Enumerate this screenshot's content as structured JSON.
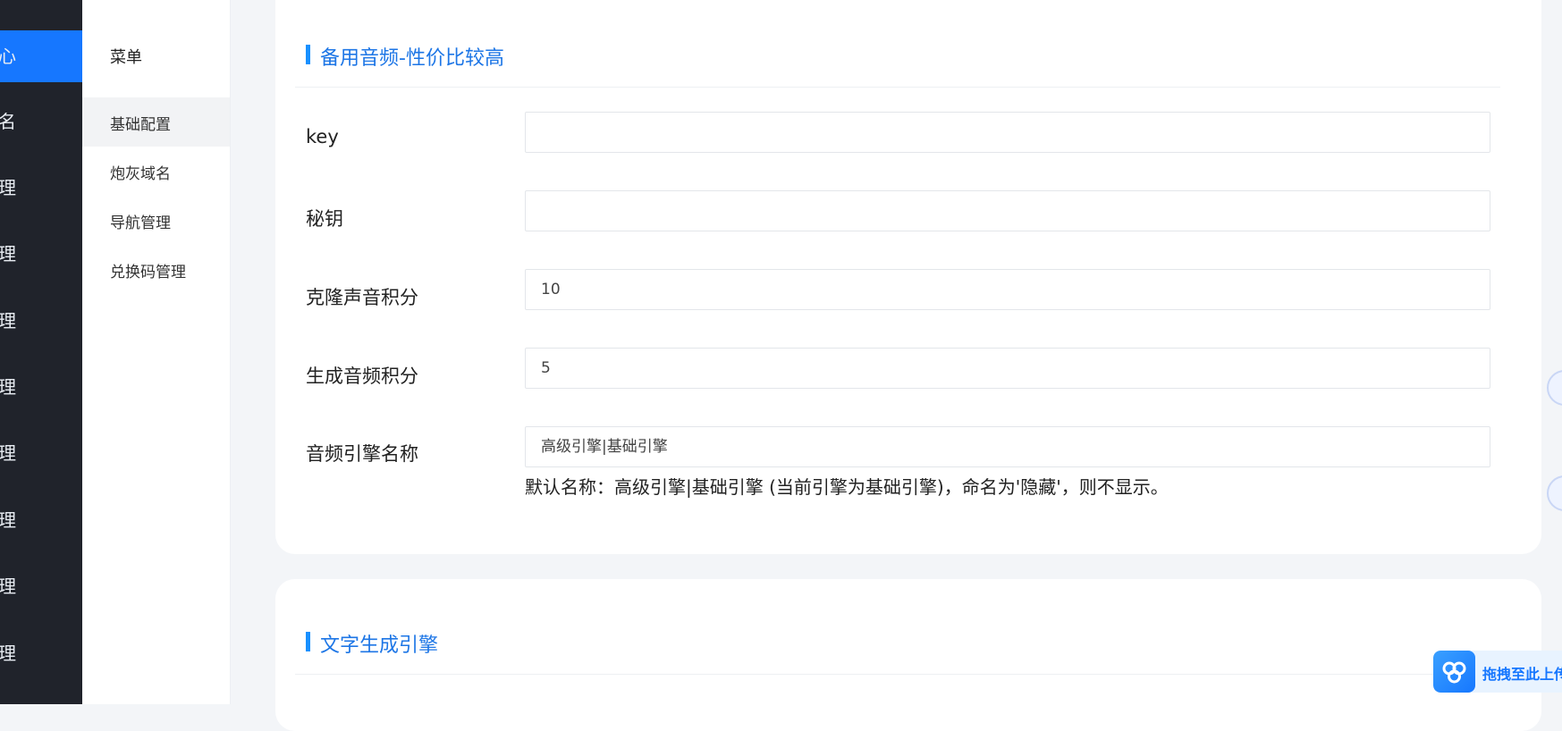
{
  "main_nav": {
    "items": [
      {
        "label": "心"
      },
      {
        "label": "名"
      },
      {
        "label": "理"
      },
      {
        "label": "理"
      },
      {
        "label": "理"
      },
      {
        "label": "理"
      },
      {
        "label": "理"
      },
      {
        "label": "理"
      },
      {
        "label": "理"
      },
      {
        "label": "理"
      }
    ],
    "active_color": "#1677ff",
    "background": "#20232b"
  },
  "submenu": {
    "header": "菜单",
    "items": [
      {
        "label": "基础配置",
        "active": true
      },
      {
        "label": "炮灰域名"
      },
      {
        "label": "导航管理"
      },
      {
        "label": "兑换码管理"
      }
    ]
  },
  "section1": {
    "title": "备用音频-性价比较高",
    "fields": [
      {
        "label": "key",
        "value": ""
      },
      {
        "label": "秘钥",
        "value": ""
      },
      {
        "label": "克隆声音积分",
        "value": "10"
      },
      {
        "label": "生成音频积分",
        "value": "5"
      },
      {
        "label": "音频引擎名称",
        "value": "高级引擎|基础引擎"
      }
    ],
    "hint": "默认名称：高级引擎|基础引擎 (当前引擎为基础引擎)，命名为'隐藏'，则不显示。"
  },
  "section2": {
    "title": "文字生成引擎"
  },
  "upload_widget": {
    "label": "拖拽至此上传",
    "icon": "cloud-upload-icon"
  },
  "colors": {
    "accent": "#1677ff",
    "title_bar": "#1890ff",
    "page_bg": "#f3f5f8"
  }
}
